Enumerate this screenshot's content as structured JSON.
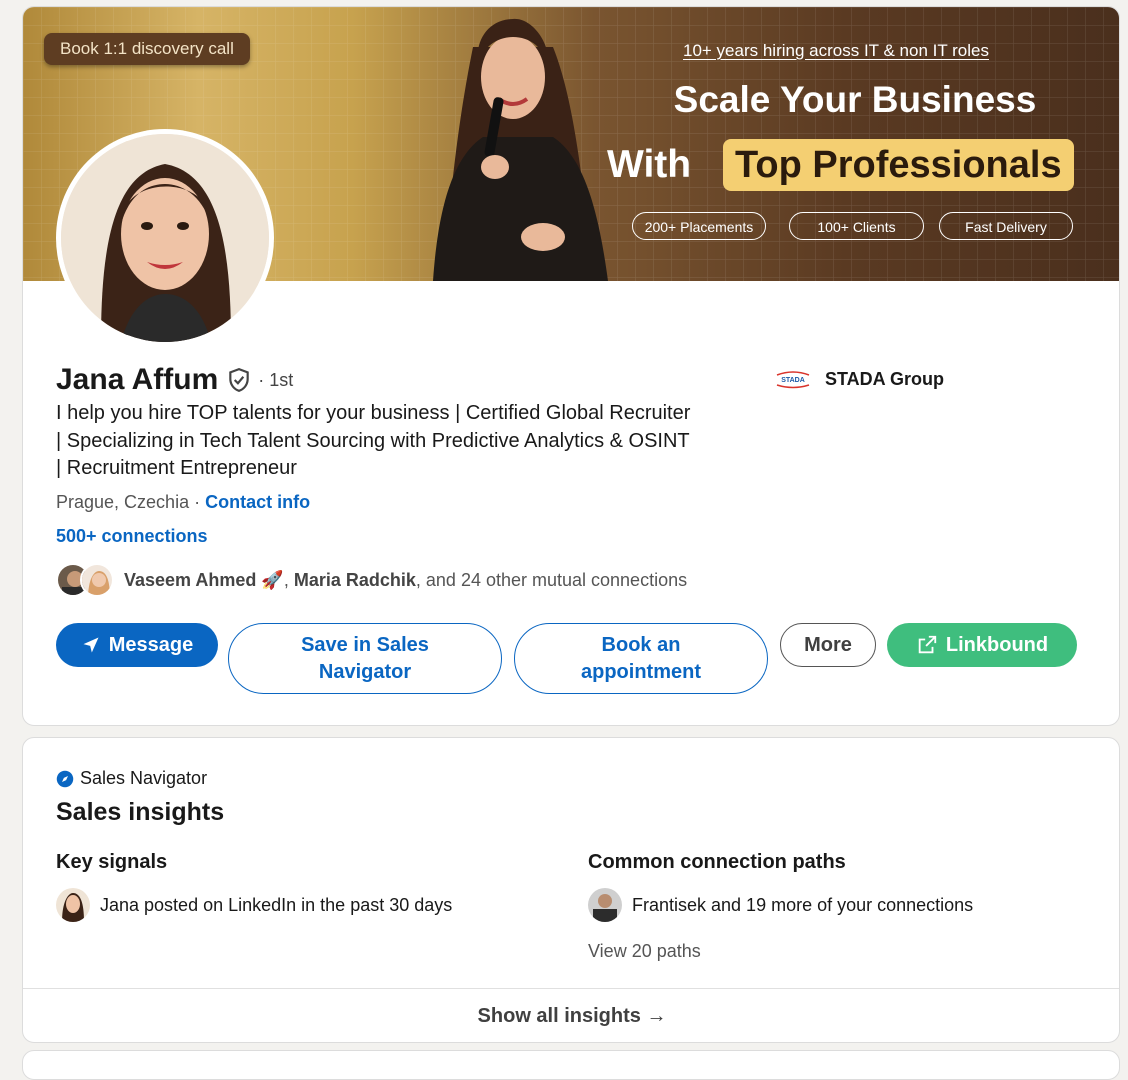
{
  "banner": {
    "cta": "Book 1:1 discovery call",
    "tagline": "10+ years hiring across IT & non IT roles",
    "headline_line1": "Scale Your Business",
    "headline_with": "With",
    "headline_highlight": "Top Professionals",
    "pills": [
      "200+ Placements",
      "100+ Clients",
      "Fast Delivery"
    ]
  },
  "profile": {
    "name": "Jana Affum",
    "degree": "· 1st",
    "headline": "I help you hire TOP talents for your business | Certified Global Recruiter | Specializing in Tech Talent Sourcing with Predictive Analytics & OSINT | Recruitment Entrepreneur",
    "location": "Prague, Czechia ·",
    "contact_link": "Contact info",
    "connections": "500+ connections",
    "mutual": {
      "name1": "Vaseem Ahmed",
      "emoji1": "🚀",
      "sep": ", ",
      "name2": "Maria Radchik",
      "rest": ", and 24 other mutual connections"
    },
    "company": {
      "logo_text": "STADA",
      "name": "STADA Group"
    }
  },
  "actions": {
    "message": "Message",
    "save_sales_nav": "Save in Sales Navigator",
    "book_appointment": "Book an appointment",
    "more": "More",
    "linkbound": "Linkbound"
  },
  "insights": {
    "brand": "Sales Navigator",
    "title": "Sales insights",
    "key_signals_title": "Key signals",
    "key_signal": "Jana posted on LinkedIn in the past 30 days",
    "paths_title": "Common connection paths",
    "path_text": "Frantisek and 19 more of your connections",
    "view_paths": "View 20 paths",
    "show_all": "Show all insights →"
  },
  "colors": {
    "linkedin_blue": "#0a66c2",
    "linkbound_green": "#3fbe7e",
    "banner_gold": "#f4cf72",
    "banner_brown": "#4a2f1d"
  },
  "icons": [
    "verified-shield-icon",
    "send-icon",
    "external-link-icon",
    "compass-icon"
  ]
}
